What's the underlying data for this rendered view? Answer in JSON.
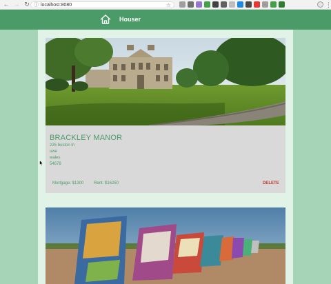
{
  "browser": {
    "url": "localhost:8080",
    "back_icon": "arrow-left-icon",
    "forward_icon": "arrow-right-icon",
    "reload_icon": "reload-icon",
    "extension_colors": [
      "#9e9e9e",
      "#6f6f6f",
      "#9575cd",
      "#43a047",
      "#424242",
      "#616161",
      "#bdbdbd",
      "#1e88e5",
      "#4a4a4a",
      "#e53935",
      "#9e9e9e",
      "#43a047",
      "#2e7d32"
    ]
  },
  "header": {
    "brand": "Houser",
    "home_icon": "home-icon",
    "color": "#4a9b67"
  },
  "listings": [
    {
      "name": "BRACKLEY MANOR",
      "address_lines": [
        "225 boston ln",
        "uwe",
        "wales",
        "54678"
      ],
      "mortgage": "Mortgage: $1300",
      "rent": "Rent: $16250",
      "delete_label": "DELETE"
    },
    {
      "photo": "painted cars photo"
    }
  ]
}
